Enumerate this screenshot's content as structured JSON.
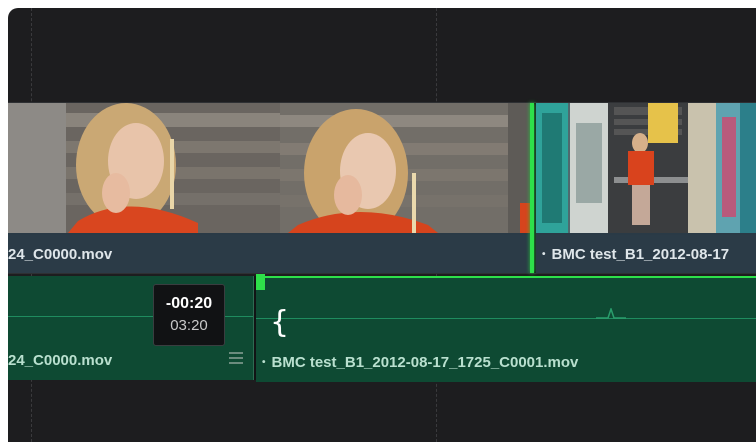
{
  "video_track": {
    "clip_left": {
      "name": "24_C0000.mov"
    },
    "clip_right": {
      "name": "BMC test_B1_2012-08-17"
    }
  },
  "audio_track": {
    "clip_left": {
      "name": "24_C0000.mov"
    },
    "clip_right": {
      "name": "BMC test_B1_2012-08-17_1725_C0001.mov"
    }
  },
  "trim_tooltip": {
    "offset": "-00:20",
    "duration": "03:20"
  },
  "icons": {
    "menu": "hamburger-icon",
    "trim_cursor": "trim-brace-icon"
  },
  "colors": {
    "edit_point": "#2ee04a",
    "video_clip": "#2b3b47",
    "audio_clip": "#0e4a33"
  }
}
